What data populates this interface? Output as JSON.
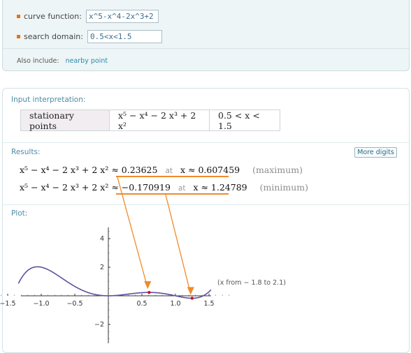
{
  "form": {
    "curve_label": "curve function:",
    "curve_value": "x^5-x^4-2x^3+2",
    "domain_label": "search domain:",
    "domain_value": "0.5<x<1.5",
    "also_label": "Also include:",
    "also_link": "nearby point"
  },
  "pods": {
    "input_title": "Input interpretation:",
    "interp": {
      "head": "stationary points",
      "expr": "x⁵ − x⁴ − 2 x³ + 2 x²",
      "domain": "0.5 < x < 1.5"
    },
    "results_title": "Results:",
    "more_digits": "More digits",
    "results": [
      {
        "expr": "x⁵ − x⁴ − 2 x³ + 2 x² ≈ 0.23625",
        "at": "at",
        "x": "x ≈ 0.607459",
        "kind": "(maximum)"
      },
      {
        "expr": "x⁵ − x⁴ − 2 x³ + 2 x² ≈ −0.170919",
        "at": "at",
        "x": "x ≈ 1.24789",
        "kind": "(minimum)"
      }
    ],
    "plot_title": "Plot:",
    "plot_note": "(x from − 1.8 to 2.1)"
  },
  "colors": {
    "accent": "#e8720c",
    "link": "#2a8aa8",
    "curve": "#5f4fa0",
    "highlight": "#f08a2a",
    "point": "#cc1122"
  },
  "chart_data": {
    "type": "line",
    "title": "",
    "xlabel": "",
    "ylabel": "",
    "function": "x^5 - x^4 - 2x^3 + 2x^2",
    "xlim": [
      -1.8,
      2.1
    ],
    "xticks": [
      -1.5,
      -1.0,
      -0.5,
      0.5,
      1.0,
      1.5
    ],
    "xtick_labels": [
      "−1.5",
      "−1.0",
      "−0.5",
      "0.5",
      "1.0",
      "1.5"
    ],
    "yticks": [
      -2,
      2,
      4
    ],
    "ytick_labels": [
      "−2",
      "2",
      "4"
    ],
    "ylim": [
      -3.0,
      4.6
    ],
    "points": [
      {
        "x": 0.607459,
        "y": 0.23625,
        "label": "maximum"
      },
      {
        "x": 1.24789,
        "y": -0.170919,
        "label": "minimum"
      }
    ]
  }
}
